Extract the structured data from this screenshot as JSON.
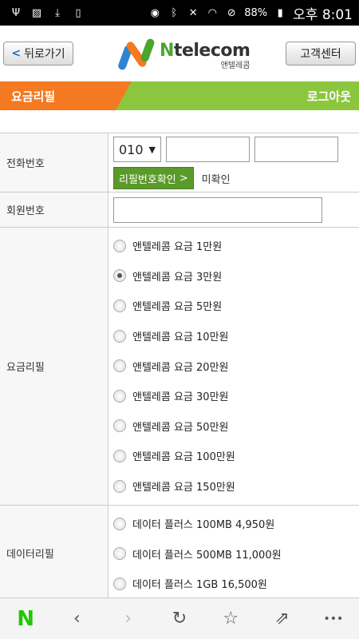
{
  "status_bar": {
    "left_icons": [
      "usb-icon",
      "image-icon",
      "download-icon",
      "file-icon"
    ],
    "right_icons": [
      "eye-icon",
      "bluetooth-icon",
      "mute-icon",
      "wifi-icon",
      "no-sim-icon"
    ],
    "battery": "88%",
    "time": "오후 8:01"
  },
  "header": {
    "back_label": "뒤로가기",
    "back_arrow": "<",
    "logo_main_n": "N",
    "logo_main": "telecom",
    "logo_sub": "앤텔레콤",
    "cs_label": "고객센터",
    "colors": {
      "logo_green": "#4aa52e",
      "logo_orange": "#f47920",
      "logo_blue": "#2e84d0"
    }
  },
  "nav": {
    "title": "요금리필",
    "logout": "로그아웃",
    "colors": {
      "orange": "#f47920",
      "green": "#8cc63f"
    }
  },
  "form": {
    "phone": {
      "label": "전화번호",
      "prefix": "010",
      "prefix_arrow": "▼",
      "verify_button": "리필번호확인",
      "verify_arrow": ">",
      "verify_status": "미확인"
    },
    "member": {
      "label": "회원번호"
    },
    "refill": {
      "label": "요금리필",
      "options": [
        {
          "label": "앤텔레콤 요금 1만원",
          "checked": false
        },
        {
          "label": "앤텔레콤 요금 3만원",
          "checked": true
        },
        {
          "label": "앤텔레콤 요금 5만원",
          "checked": false
        },
        {
          "label": "앤텔레콤 요금 10만원",
          "checked": false
        },
        {
          "label": "앤텔레콤 요금 20만원",
          "checked": false
        },
        {
          "label": "앤텔레콤 요금 30만원",
          "checked": false
        },
        {
          "label": "앤텔레콤 요금 50만원",
          "checked": false
        },
        {
          "label": "앤텔레콤 요금 100만원",
          "checked": false
        },
        {
          "label": "앤텔레콤 요금 150만원",
          "checked": false
        }
      ]
    },
    "data": {
      "label": "데이터리필",
      "options": [
        {
          "label": "데이터 플러스 100MB 4,950원",
          "checked": false
        },
        {
          "label": "데이터 플러스 500MB 11,000원",
          "checked": false
        },
        {
          "label": "데이터 플러스 1GB 16,500원",
          "checked": false
        }
      ]
    }
  },
  "bottom_bar": {
    "items": [
      {
        "name": "naver-home-icon",
        "glyph": "N"
      },
      {
        "name": "back-icon",
        "glyph": "‹"
      },
      {
        "name": "forward-icon",
        "glyph": "›"
      },
      {
        "name": "refresh-icon",
        "glyph": "↻"
      },
      {
        "name": "bookmark-star-icon",
        "glyph": "☆"
      },
      {
        "name": "share-icon",
        "glyph": "⇗"
      },
      {
        "name": "more-icon",
        "glyph": "•••"
      }
    ]
  }
}
